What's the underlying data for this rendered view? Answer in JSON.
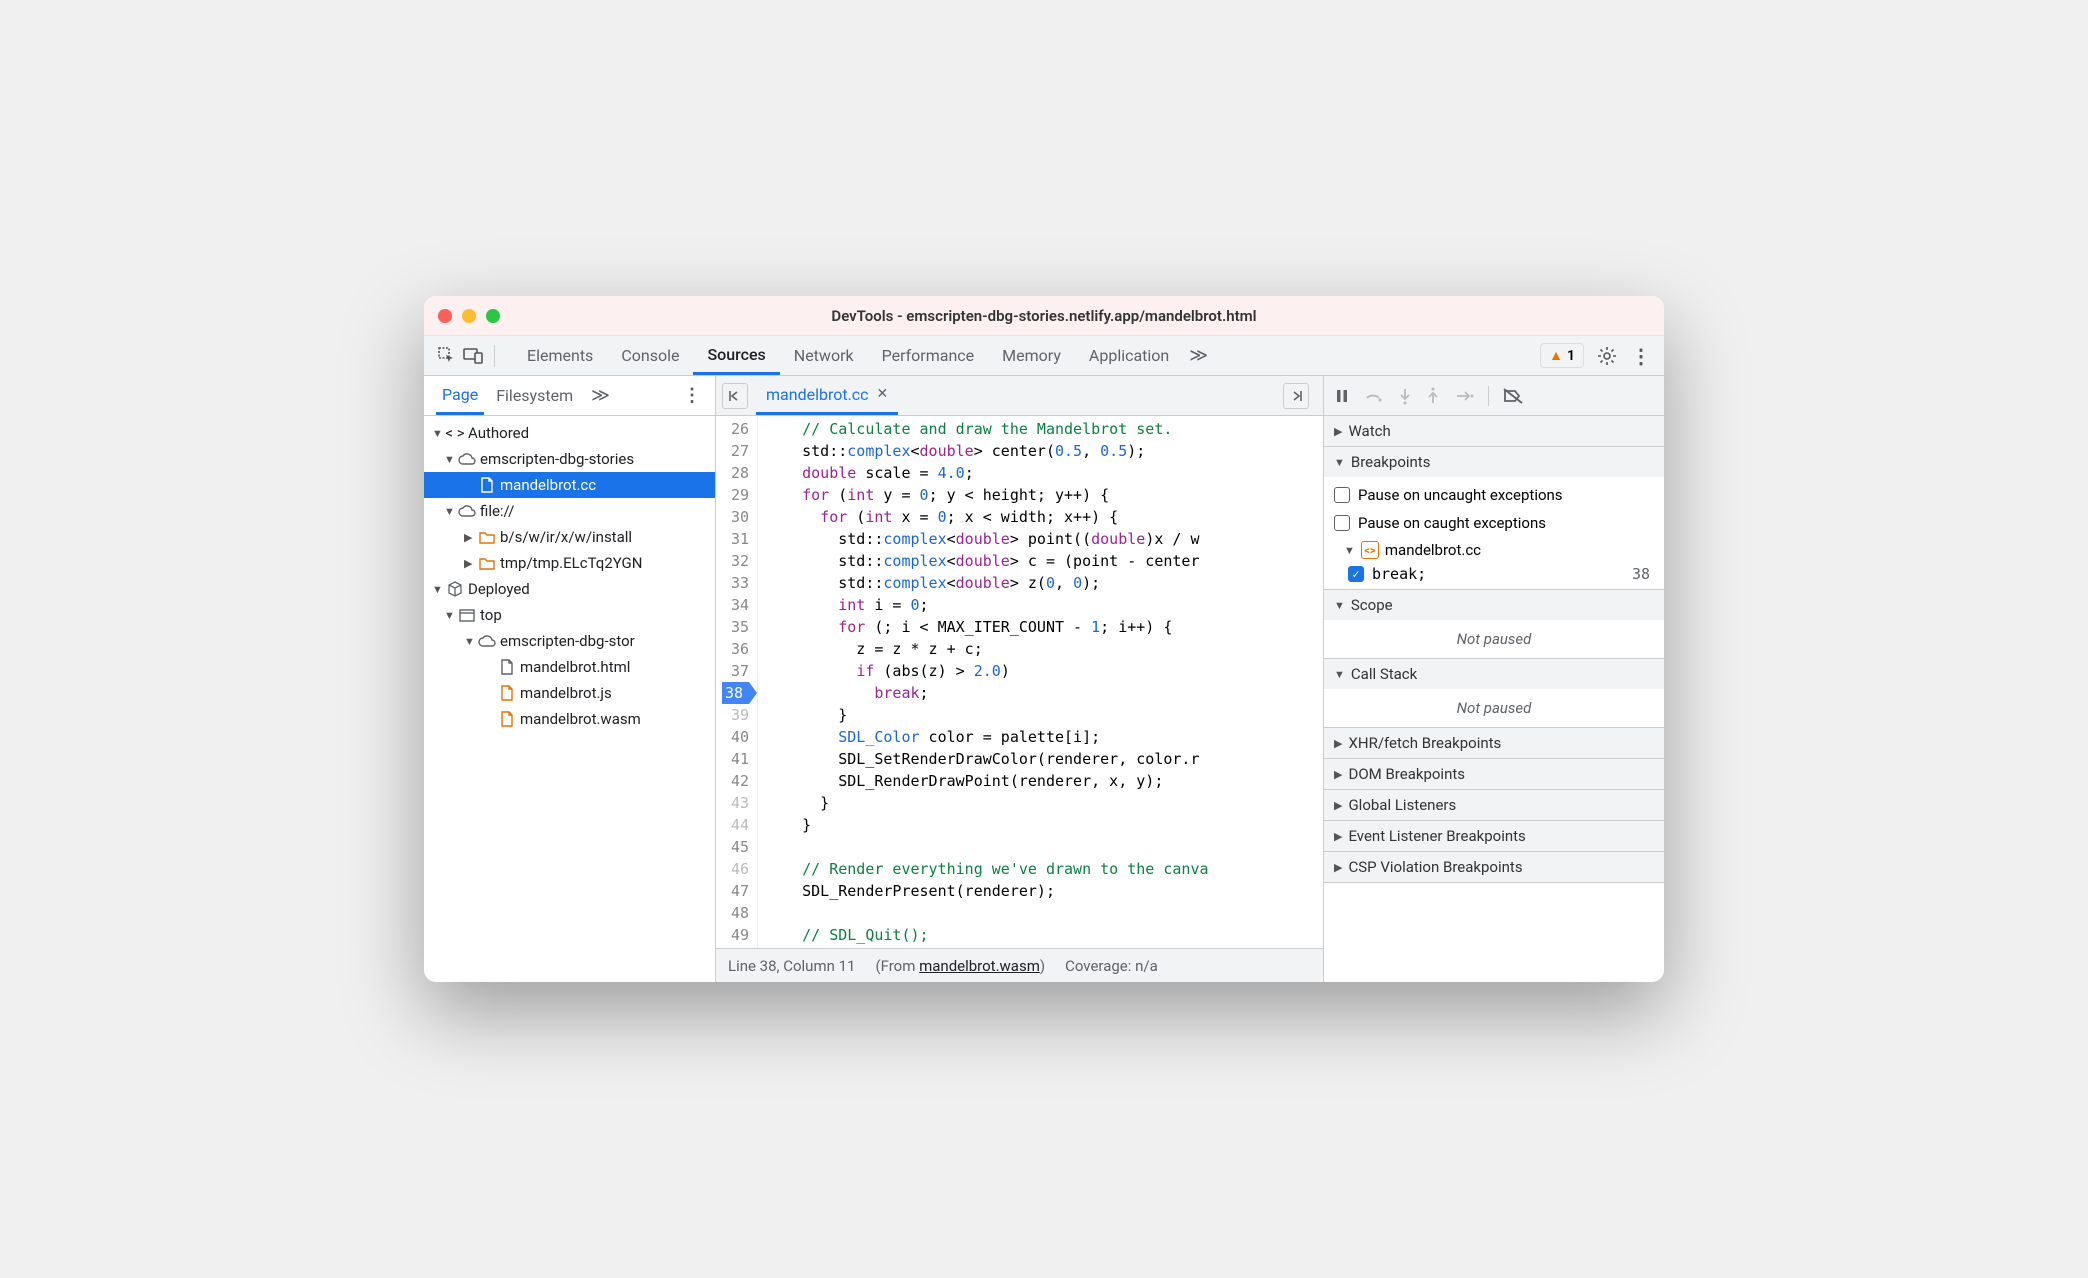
{
  "titlebar": "DevTools - emscripten-dbg-stories.netlify.app/mandelbrot.html",
  "toolbar_tabs": {
    "elements": "Elements",
    "console": "Console",
    "sources": "Sources",
    "network": "Network",
    "performance": "Performance",
    "memory": "Memory",
    "application": "Application"
  },
  "warnings_count": "1",
  "left_tabs": {
    "page": "Page",
    "filesystem": "Filesystem"
  },
  "tree": {
    "authored": "Authored",
    "cloud1": "emscripten-dbg-stories",
    "mandelbrot_cc": "mandelbrot.cc",
    "file_scheme": "file://",
    "folder1": "b/s/w/ir/x/w/install",
    "folder2": "tmp/tmp.ELcTq2YGN",
    "deployed": "Deployed",
    "top": "top",
    "cloud2": "emscripten-dbg-stor",
    "file_html": "mandelbrot.html",
    "file_js": "mandelbrot.js",
    "file_wasm": "mandelbrot.wasm"
  },
  "file_tab": "mandelbrot.cc",
  "code_lines": [
    {
      "n": "26",
      "c": "",
      "tokens": [
        [
          "    ",
          ""
        ],
        [
          "// Calculate and draw the Mandelbrot set.",
          "c-com"
        ]
      ]
    },
    {
      "n": "27",
      "c": "",
      "tokens": [
        [
          "    ",
          ""
        ],
        [
          "std",
          ""
        ],
        [
          "::",
          ""
        ],
        [
          "complex",
          "c-type"
        ],
        [
          "<",
          ""
        ],
        [
          "double",
          "c-kw"
        ],
        [
          "> center(",
          ""
        ],
        [
          "0.5",
          "c-num"
        ],
        [
          ", ",
          ""
        ],
        [
          "0.5",
          "c-num"
        ],
        [
          ");",
          ""
        ]
      ]
    },
    {
      "n": "28",
      "c": "",
      "tokens": [
        [
          "    ",
          ""
        ],
        [
          "double",
          "c-kw"
        ],
        [
          " scale = ",
          ""
        ],
        [
          "4.0",
          "c-num"
        ],
        [
          ";",
          ""
        ]
      ]
    },
    {
      "n": "29",
      "c": "",
      "tokens": [
        [
          "    ",
          ""
        ],
        [
          "for",
          "c-kw"
        ],
        [
          " (",
          ""
        ],
        [
          "int",
          "c-kw"
        ],
        [
          " y = ",
          ""
        ],
        [
          "0",
          "c-num"
        ],
        [
          "; y < height; y++) {",
          ""
        ]
      ]
    },
    {
      "n": "30",
      "c": "",
      "tokens": [
        [
          "      ",
          ""
        ],
        [
          "for",
          "c-kw"
        ],
        [
          " (",
          ""
        ],
        [
          "int",
          "c-kw"
        ],
        [
          " x = ",
          ""
        ],
        [
          "0",
          "c-num"
        ],
        [
          "; x < width; x++) {",
          ""
        ]
      ]
    },
    {
      "n": "31",
      "c": "",
      "tokens": [
        [
          "        ",
          ""
        ],
        [
          "std",
          ""
        ],
        [
          "::",
          ""
        ],
        [
          "complex",
          "c-type"
        ],
        [
          "<",
          ""
        ],
        [
          "double",
          "c-kw"
        ],
        [
          "> point((",
          ""
        ],
        [
          "double",
          "c-kw"
        ],
        [
          ")x / w",
          ""
        ]
      ]
    },
    {
      "n": "32",
      "c": "",
      "tokens": [
        [
          "        ",
          ""
        ],
        [
          "std",
          ""
        ],
        [
          "::",
          ""
        ],
        [
          "complex",
          "c-type"
        ],
        [
          "<",
          ""
        ],
        [
          "double",
          "c-kw"
        ],
        [
          "> c = (point - center",
          ""
        ]
      ]
    },
    {
      "n": "33",
      "c": "",
      "tokens": [
        [
          "        ",
          ""
        ],
        [
          "std",
          ""
        ],
        [
          "::",
          ""
        ],
        [
          "complex",
          "c-type"
        ],
        [
          "<",
          ""
        ],
        [
          "double",
          "c-kw"
        ],
        [
          "> z(",
          ""
        ],
        [
          "0",
          "c-num"
        ],
        [
          ", ",
          ""
        ],
        [
          "0",
          "c-num"
        ],
        [
          ");",
          ""
        ]
      ]
    },
    {
      "n": "34",
      "c": "",
      "tokens": [
        [
          "        ",
          ""
        ],
        [
          "int",
          "c-kw"
        ],
        [
          " i = ",
          ""
        ],
        [
          "0",
          "c-num"
        ],
        [
          ";",
          ""
        ]
      ]
    },
    {
      "n": "35",
      "c": "",
      "tokens": [
        [
          "        ",
          ""
        ],
        [
          "for",
          "c-kw"
        ],
        [
          " (; i < MAX_ITER_COUNT - ",
          ""
        ],
        [
          "1",
          "c-num"
        ],
        [
          "; i++) {",
          ""
        ]
      ]
    },
    {
      "n": "36",
      "c": "",
      "tokens": [
        [
          "          z = z * z + c;",
          ""
        ]
      ]
    },
    {
      "n": "37",
      "c": "",
      "tokens": [
        [
          "          ",
          ""
        ],
        [
          "if",
          "c-kw"
        ],
        [
          " (abs(z) > ",
          ""
        ],
        [
          "2.0",
          "c-num"
        ],
        [
          ")",
          ""
        ]
      ]
    },
    {
      "n": "38",
      "c": "bp",
      "tokens": [
        [
          "            ",
          ""
        ],
        [
          "break",
          "c-kw"
        ],
        [
          ";",
          ""
        ]
      ]
    },
    {
      "n": "39",
      "c": "dim",
      "tokens": [
        [
          "        }",
          ""
        ]
      ]
    },
    {
      "n": "40",
      "c": "",
      "tokens": [
        [
          "        ",
          ""
        ],
        [
          "SDL_Color",
          "c-type"
        ],
        [
          " color = palette[i];",
          ""
        ]
      ]
    },
    {
      "n": "41",
      "c": "",
      "tokens": [
        [
          "        SDL_SetRenderDrawColor(renderer, color.r",
          ""
        ]
      ]
    },
    {
      "n": "42",
      "c": "",
      "tokens": [
        [
          "        SDL_RenderDrawPoint(renderer, x, y);",
          ""
        ]
      ]
    },
    {
      "n": "43",
      "c": "dim",
      "tokens": [
        [
          "      }",
          ""
        ]
      ]
    },
    {
      "n": "44",
      "c": "dim",
      "tokens": [
        [
          "    }",
          ""
        ]
      ]
    },
    {
      "n": "45",
      "c": "",
      "tokens": [
        [
          "",
          ""
        ]
      ]
    },
    {
      "n": "46",
      "c": "dim",
      "tokens": [
        [
          "    ",
          ""
        ],
        [
          "// Render everything we've drawn to the canva",
          "c-com"
        ]
      ]
    },
    {
      "n": "47",
      "c": "",
      "tokens": [
        [
          "    SDL_RenderPresent(renderer);",
          ""
        ]
      ]
    },
    {
      "n": "48",
      "c": "",
      "tokens": [
        [
          "",
          ""
        ]
      ]
    },
    {
      "n": "49",
      "c": "",
      "tokens": [
        [
          "    ",
          ""
        ],
        [
          "// SDL_Quit();",
          "c-com"
        ]
      ]
    }
  ],
  "status": {
    "pos": "Line 38, Column 11",
    "from_prefix": "(From ",
    "from_link": "mandelbrot.wasm",
    "from_suffix": ")",
    "coverage": "Coverage: n/a"
  },
  "dbg": {
    "watch": "Watch",
    "breakpoints": "Breakpoints",
    "pause_uncaught": "Pause on uncaught exceptions",
    "pause_caught": "Pause on caught exceptions",
    "bp_file": "mandelbrot.cc",
    "bp_code": "break;",
    "bp_line": "38",
    "scope": "Scope",
    "not_paused": "Not paused",
    "call_stack": "Call Stack",
    "xhr": "XHR/fetch Breakpoints",
    "dom": "DOM Breakpoints",
    "global": "Global Listeners",
    "event": "Event Listener Breakpoints",
    "csp": "CSP Violation Breakpoints"
  }
}
